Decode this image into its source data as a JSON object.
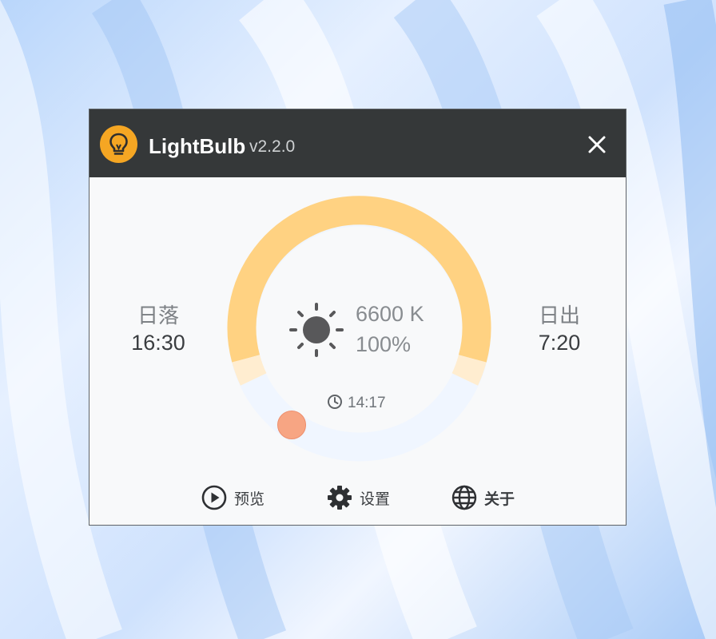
{
  "app": {
    "title": "LightBulb",
    "version": "v2.2.0"
  },
  "sunset": {
    "label": "日落",
    "time": "16:30"
  },
  "sunrise": {
    "label": "日出",
    "time": "7:20"
  },
  "status": {
    "temperature": "6600 K",
    "brightness": "100%",
    "clock": "14:17"
  },
  "nav": {
    "preview": "预览",
    "settings": "设置",
    "about": "关于"
  },
  "colors": {
    "day_arc": "#ffd282",
    "transition": "#ffedd0",
    "night_arc": "#f0f6ff",
    "titlebar": "#353839",
    "accent": "#f5a623",
    "marker": "#f7a583"
  }
}
